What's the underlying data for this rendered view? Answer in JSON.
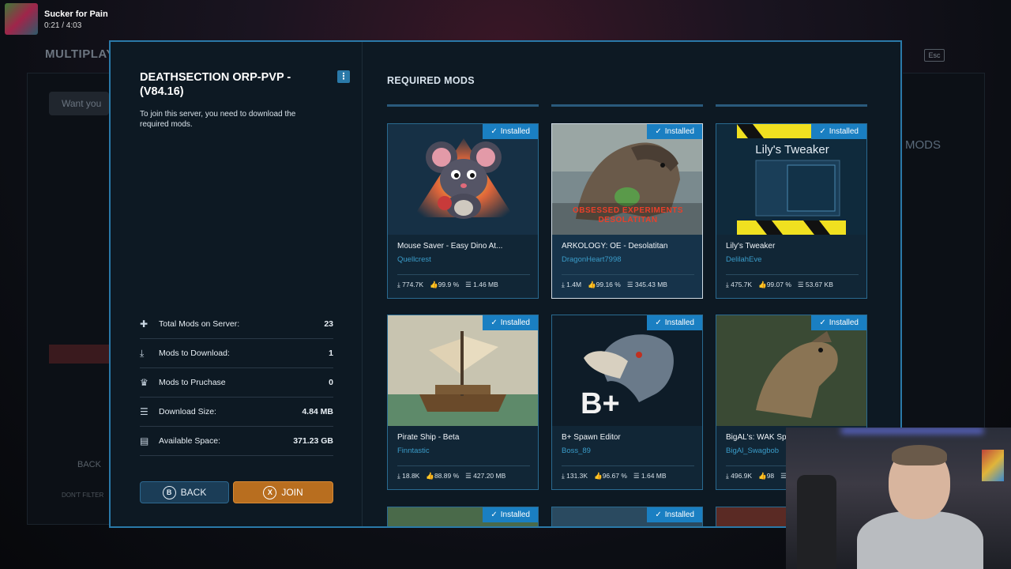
{
  "background": {
    "title": "MULTIPLAYER",
    "search_placeholder": "Want you",
    "esc_label": "Esc",
    "mods_label": "MODS",
    "back_label": "BACK",
    "dont_filter_label": "DON'T FILTER"
  },
  "media": {
    "title": "Sucker for Pain",
    "time": "0:21 / 4:03"
  },
  "server": {
    "title": "DEATHSECTION ORP-PVP - (V84.16)",
    "description": "To join this server, you need to download the required mods."
  },
  "stats": [
    {
      "icon": "puzzle-icon",
      "glyph": "✚",
      "label": "Total Mods on Server:",
      "value": "23"
    },
    {
      "icon": "download-icon",
      "glyph": "⤓",
      "label": "Mods to Download:",
      "value": "1"
    },
    {
      "icon": "crown-icon",
      "glyph": "♛",
      "label": "Mods to Pruchase",
      "value": "0"
    },
    {
      "icon": "database-icon",
      "glyph": "☰",
      "label": "Download Size:",
      "value": "4.84 MB"
    },
    {
      "icon": "storage-icon",
      "glyph": "▤",
      "label": "Available Space:",
      "value": "371.23 GB"
    }
  ],
  "buttons": {
    "back_key": "B",
    "back_label": "BACK",
    "join_key": "X",
    "join_label": "JOIN"
  },
  "required_mods_title": "REQUIRED MODS",
  "installed_label": "Installed",
  "mods": [
    {
      "name": "Mouse Saver - Easy Dino At...",
      "author": "Quellcrest",
      "downloads": "774.7K",
      "rating": "99.9 %",
      "size": "1.46 MB"
    },
    {
      "name": "ARKOLOGY: OE - Desolatitan",
      "author": "DragonHeart7998",
      "downloads": "1.4M",
      "rating": "99.16 %",
      "size": "345.43 MB"
    },
    {
      "name": "Lily's Tweaker",
      "author": "DelilahEve",
      "downloads": "475.7K",
      "rating": "99.07 %",
      "size": "53.67 KB"
    },
    {
      "name": "Pirate Ship - Beta",
      "author": "Finntastic",
      "downloads": "18.8K",
      "rating": "88.89 %",
      "size": "427.20 MB"
    },
    {
      "name": "B+ Spawn Editor",
      "author": "Boss_89",
      "downloads": "131.3K",
      "rating": "96.67 %",
      "size": "1.64 MB"
    },
    {
      "name": "BigAL's: WAK Sp",
      "author": "BigAl_Swagbob",
      "downloads": "496.9K",
      "rating": "98",
      "size": ""
    }
  ],
  "thumb_text": {
    "mod2_caption": "OBSESSED EXPERIMENTS DESOLATITAN",
    "mod3_caption": "Lily's Tweaker",
    "mod5_caption": "B+"
  },
  "colors": {
    "accent": "#2a79a8",
    "installed_badge": "#1a7fc2",
    "join_button": "#b86e1f",
    "author_link": "#3a9cc9"
  }
}
